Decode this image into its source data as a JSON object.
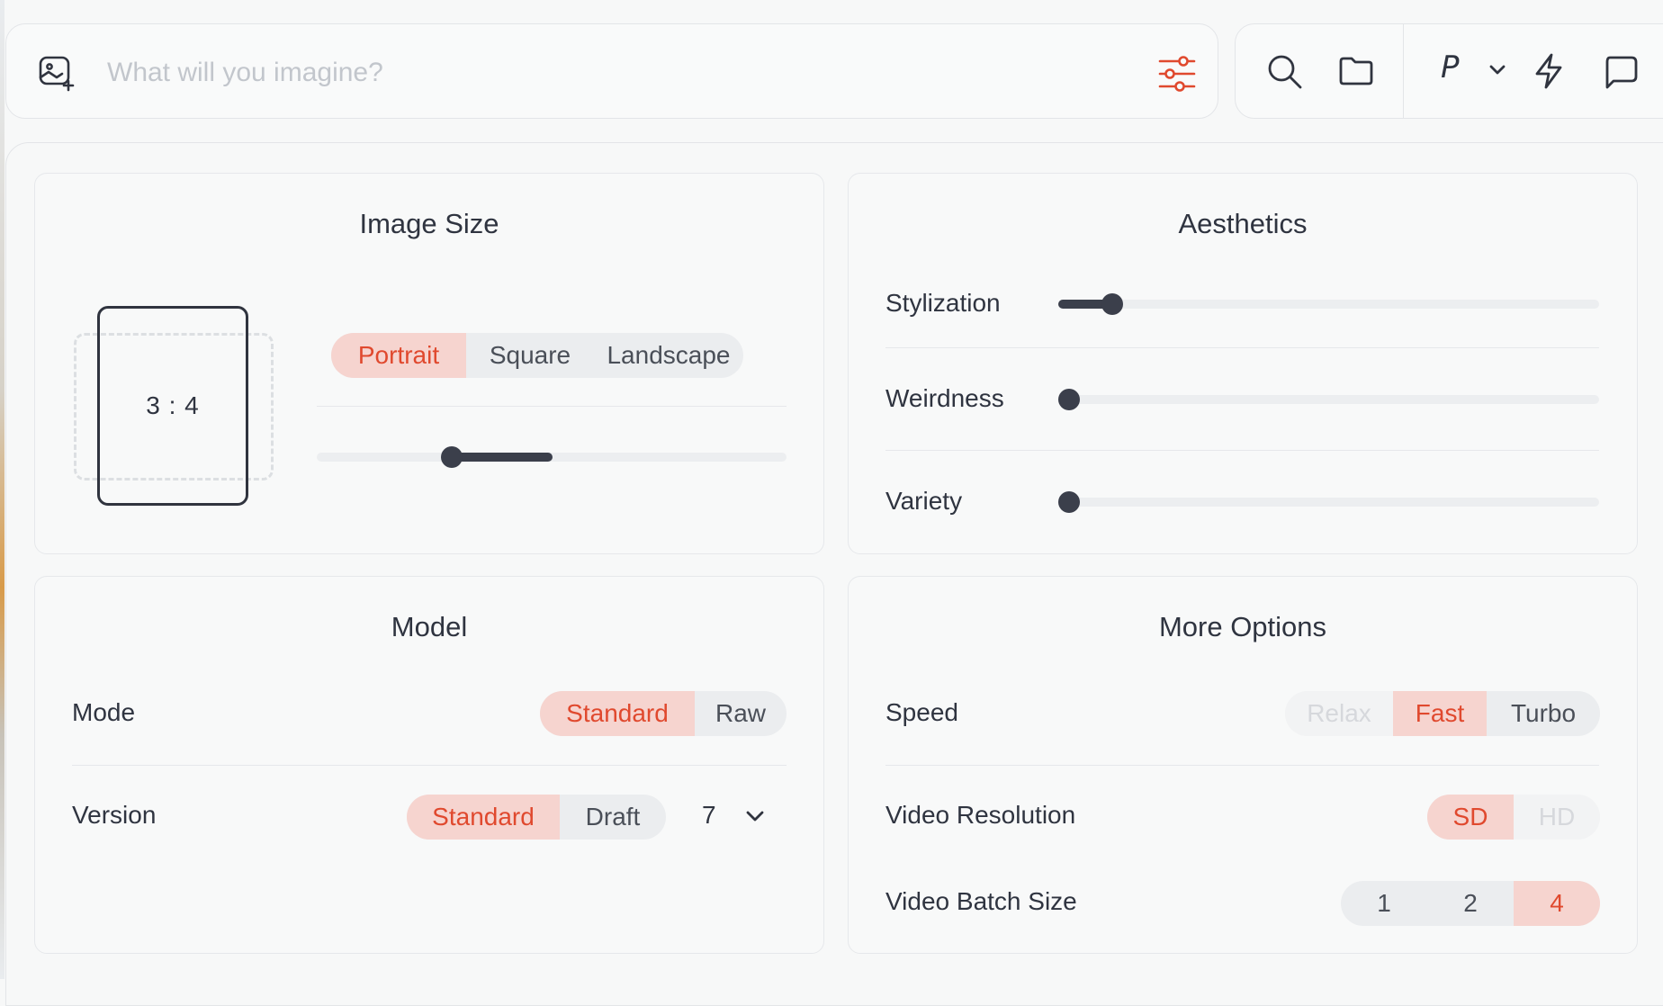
{
  "prompt": {
    "placeholder": "What will you imagine?"
  },
  "toolbar": {
    "profile_letter": "P"
  },
  "image_size": {
    "title": "Image Size",
    "ratio": "3 : 4",
    "orientation_options": [
      "Portrait",
      "Square",
      "Landscape"
    ],
    "selected": "Portrait"
  },
  "aesthetics": {
    "title": "Aesthetics",
    "sliders": [
      {
        "label": "Stylization",
        "value": 0.1
      },
      {
        "label": "Weirdness",
        "value": 0.0
      },
      {
        "label": "Variety",
        "value": 0.0
      }
    ]
  },
  "model": {
    "title": "Model",
    "mode_label": "Mode",
    "mode_options": [
      "Standard",
      "Raw"
    ],
    "mode_selected": "Standard",
    "version_label": "Version",
    "version_options": [
      "Standard",
      "Draft"
    ],
    "version_selected": "Standard",
    "version_number": "7"
  },
  "more_options": {
    "title": "More Options",
    "speed_label": "Speed",
    "speed_options": [
      "Relax",
      "Fast",
      "Turbo"
    ],
    "speed_selected": "Fast",
    "video_resolution_label": "Video Resolution",
    "video_resolution_options": [
      "SD",
      "HD"
    ],
    "video_resolution_selected": "SD",
    "video_batch_label": "Video Batch Size",
    "video_batch_options": [
      "1",
      "2",
      "4"
    ],
    "video_batch_selected": "4"
  },
  "colors": {
    "accent": "#e0492e",
    "accent_bg": "#f6d4cf",
    "knob": "#3b3f4b"
  }
}
